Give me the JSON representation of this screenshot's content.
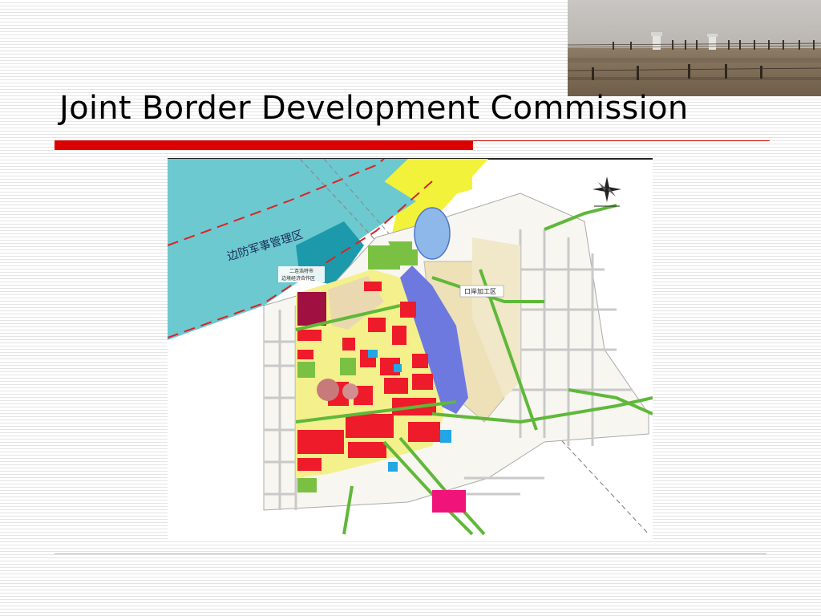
{
  "slide": {
    "title": "Joint Border Development Commission"
  },
  "photo": {
    "description_icon": "border-fence-photo"
  },
  "map": {
    "zone_military": "边防军事管理区",
    "zone_cooperation_line1": "二连浩特市",
    "zone_cooperation_line2": "边境经济合作区",
    "zone_processing": "口岸加工区",
    "icon": "compass-rose-icon"
  },
  "colors": {
    "accent_red": "#dd0000",
    "military_zone": "#6cc9cf",
    "buffer_zone": "#f2f23a",
    "commercial": "#ee1b2a",
    "residential": "#f4f08c",
    "water": "#6e79e0",
    "green": "#7ac143"
  }
}
